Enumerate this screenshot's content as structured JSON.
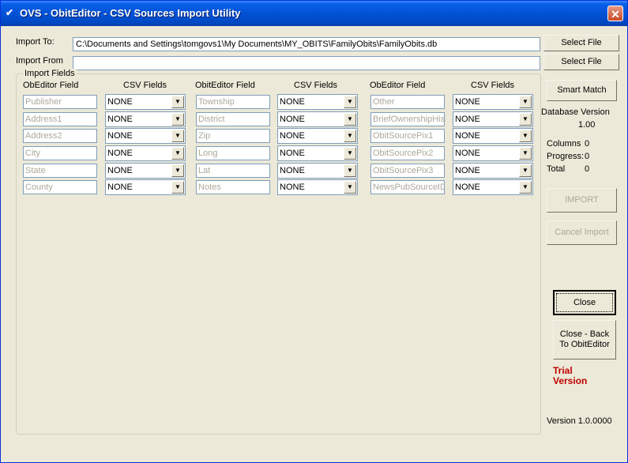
{
  "window": {
    "title": "OVS - ObitEditor - CSV Sources Import Utility",
    "close_label": "✕"
  },
  "import_to": {
    "label": "Import To:",
    "value": "C:\\Documents and Settings\\tomgovs1\\My Documents\\MY_OBITS\\FamilyObits\\FamilyObits.db",
    "button": "Select File"
  },
  "import_from": {
    "label": "Import From",
    "value": "",
    "button": "Select File"
  },
  "import_fields": {
    "group_title": "Import Fields",
    "headers": [
      "ObEditor  Field",
      "CSV Fields",
      "ObitEditor  Field",
      "CSV Fields",
      "ObEditor  Field",
      "CSV Fields"
    ],
    "columns": [
      {
        "fields": [
          "Publisher",
          "Address1",
          "Address2",
          "City",
          "State",
          "County"
        ],
        "csv": [
          "NONE",
          "NONE",
          "NONE",
          "NONE",
          "NONE",
          "NONE"
        ]
      },
      {
        "fields": [
          "Township",
          "District",
          "Zip",
          "Long",
          "Lat",
          "Notes"
        ],
        "csv": [
          "NONE",
          "NONE",
          "NONE",
          "NONE",
          "NONE",
          "NONE"
        ]
      },
      {
        "fields": [
          "Other",
          "BriefOwnershipHist",
          "ObitSourcePix1",
          "ObitSourcePix2",
          "ObitSourcePix3",
          "NewsPubSourceID"
        ],
        "csv": [
          "NONE",
          "NONE",
          "NONE",
          "NONE",
          "NONE",
          "NONE"
        ]
      }
    ]
  },
  "side": {
    "smart_match": "Smart Match",
    "db_version_label": "Database Version",
    "db_version_value": "1.00",
    "columns_label": "Columns",
    "columns_value": "0",
    "progress_label": "Progress:",
    "progress_value": "0",
    "total_label": "Total",
    "total_value": "0",
    "import_button": "IMPORT",
    "cancel_import_button": "Cancel Import",
    "close_button": "Close",
    "close_back_line1": "Close - Back",
    "close_back_line2": "To ObitEditor",
    "trial_line1": "Trial",
    "trial_line2": "Version",
    "version": "Version 1.0.0000"
  },
  "colors": {
    "titlebar": "#0252d6",
    "face": "#ece9d8",
    "trial": "#c00000",
    "disabled_text": "#aca899"
  }
}
